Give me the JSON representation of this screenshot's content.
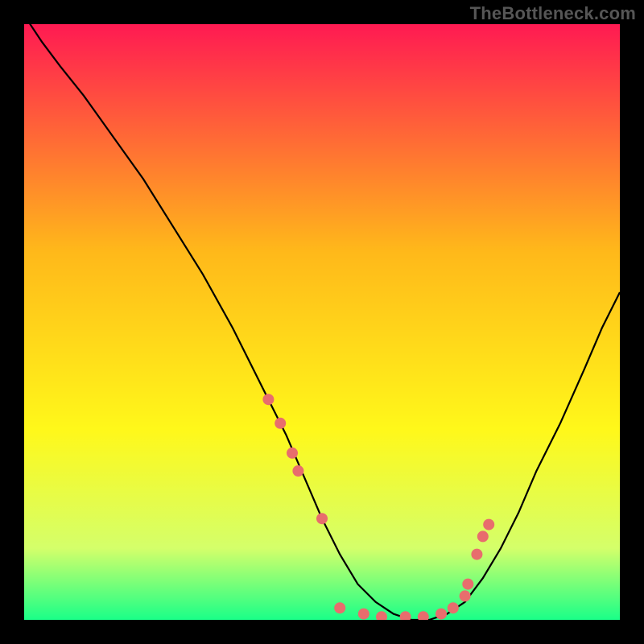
{
  "attribution": "TheBottleneck.com",
  "chart_data": {
    "type": "line",
    "title": "",
    "xlabel": "",
    "ylabel": "",
    "xlim": [
      0,
      100
    ],
    "ylim": [
      0,
      100
    ],
    "gradient_colors": {
      "top": "#ff1a52",
      "mid_upper": "#ffb81a",
      "mid": "#fff81a",
      "lower": "#d4ff6a",
      "bottom": "#1aff88"
    },
    "curve": {
      "x": [
        0,
        1,
        3,
        6,
        10,
        15,
        20,
        25,
        30,
        35,
        38,
        41,
        44,
        47,
        50,
        53,
        56,
        59,
        62,
        65,
        68,
        71,
        74,
        77,
        80,
        83,
        86,
        90,
        94,
        97,
        100
      ],
      "y": [
        102,
        100,
        97,
        93,
        88,
        81,
        74,
        66,
        58,
        49,
        43,
        37,
        31,
        24,
        17,
        11,
        6,
        3,
        1,
        0,
        0,
        1,
        3,
        7,
        12,
        18,
        25,
        33,
        42,
        49,
        55
      ]
    },
    "markers": {
      "x": [
        41,
        43,
        45,
        46,
        50,
        53,
        57,
        60,
        64,
        67,
        70,
        72,
        74,
        74.5,
        76,
        77,
        78
      ],
      "y": [
        37,
        33,
        28,
        25,
        17,
        2,
        1,
        0.5,
        0.5,
        0.5,
        1,
        2,
        4,
        6,
        11,
        14,
        16
      ],
      "color": "#e86d6d",
      "radius": 7
    }
  }
}
